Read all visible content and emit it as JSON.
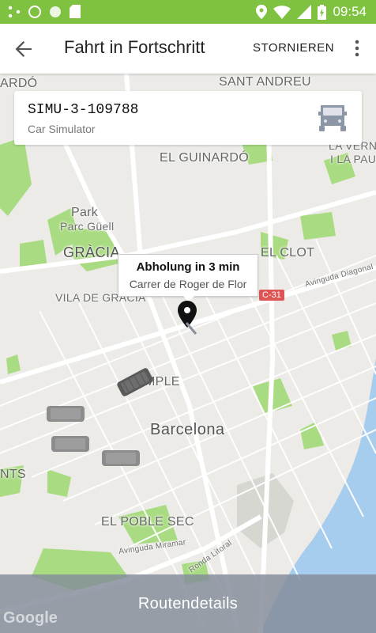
{
  "status_bar": {
    "time": "09:54",
    "left_icons": [
      "share-icon",
      "circle-icon",
      "circle-icon",
      "sd-card-icon"
    ],
    "right_icons": [
      "location-icon",
      "wifi-icon",
      "signal-icon",
      "battery-charging-icon"
    ]
  },
  "app_bar": {
    "title": "Fahrt in Fortschritt",
    "cancel_label": "STORNIEREN"
  },
  "vehicle": {
    "id": "SIMU-3-109788",
    "type": "Car Simulator"
  },
  "pickup": {
    "title": "Abholung in 3 min",
    "address": "Carrer de Roger de Flor"
  },
  "map": {
    "labels": {
      "sant_andreu": "SANT ANDREU",
      "ardo": "ARDÓ",
      "el_guinardo": "EL GUINARDÓ",
      "la_verneda": "LA VERNEDA",
      "i_la_pau": "I LA PAU",
      "park": "Park",
      "parc_guell": "Parc Güell",
      "gracia": "GRÀCIA",
      "vila_de_gracia": "VILA DE GRÀCIA",
      "el_clot": "EL CLOT",
      "c31": "C-31",
      "diagonal": "Avinguda Diagonal",
      "temple": "EMPLE",
      "barcelona": "Barcelona",
      "nts": "NTS",
      "el_poble_sec": "EL POBLE SEC",
      "mirramar": "Avinguda Miramar",
      "litoral": "Ronda Litoral"
    }
  },
  "bottom": {
    "label": "Routendetails"
  },
  "google_logo": "Google",
  "colors": {
    "status_bar": "#7fc241",
    "bottom_bar": "#828b98",
    "water": "#a6ccee",
    "park": "#a9dc82"
  }
}
